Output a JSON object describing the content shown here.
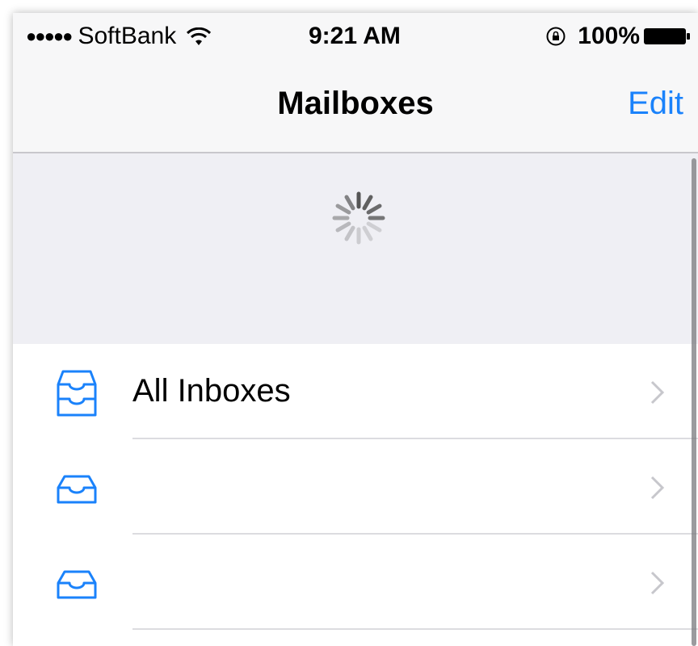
{
  "status_bar": {
    "signal": "●●●●●",
    "carrier": "SoftBank",
    "time": "9:21 AM",
    "battery_percent": "100%",
    "wifi_icon": "wifi-icon",
    "lock_icon": "rotation-lock-icon",
    "battery_icon": "battery-full-icon"
  },
  "nav": {
    "title": "Mailboxes",
    "edit_label": "Edit"
  },
  "refresh": {
    "spinner_icon": "activity-spinner-icon"
  },
  "mailboxes": [
    {
      "label": "All Inboxes",
      "icon": "all-inboxes-tray-icon"
    },
    {
      "label": "",
      "icon": "inbox-tray-icon"
    },
    {
      "label": "",
      "icon": "inbox-tray-icon"
    }
  ],
  "colors": {
    "accent": "#1a82fb",
    "nav_background": "#f7f7f8",
    "refresh_background": "#efeff4",
    "separator": "#dcdce0",
    "chevron": "#c7c7cc"
  }
}
